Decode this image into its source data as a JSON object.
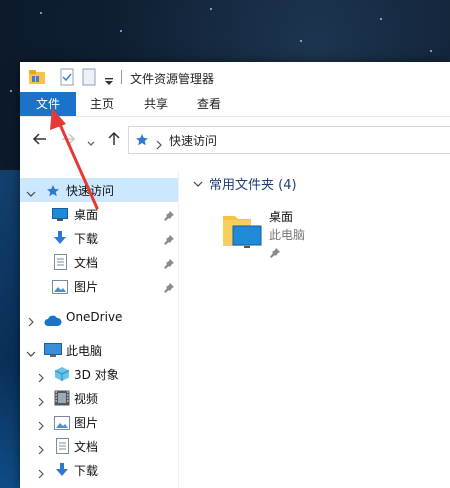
{
  "window": {
    "title": "文件资源管理器"
  },
  "ribbon": {
    "tabs": [
      "文件",
      "主页",
      "共享",
      "查看"
    ]
  },
  "address": {
    "path": "快速访问"
  },
  "sidebar": {
    "quick_access": "快速访问",
    "quick_items": [
      "桌面",
      "下载",
      "文档",
      "图片"
    ],
    "onedrive": "OneDrive",
    "this_pc": "此电脑",
    "pc_items": [
      "3D 对象",
      "视频",
      "图片",
      "文档",
      "下载"
    ]
  },
  "content": {
    "group_title": "常用文件夹",
    "group_count": "(4)",
    "tile": {
      "name": "桌面",
      "location": "此电脑"
    }
  },
  "colors": {
    "accent": "#1a73c8",
    "selection": "#cce8ff",
    "annotation": "#e53935"
  }
}
